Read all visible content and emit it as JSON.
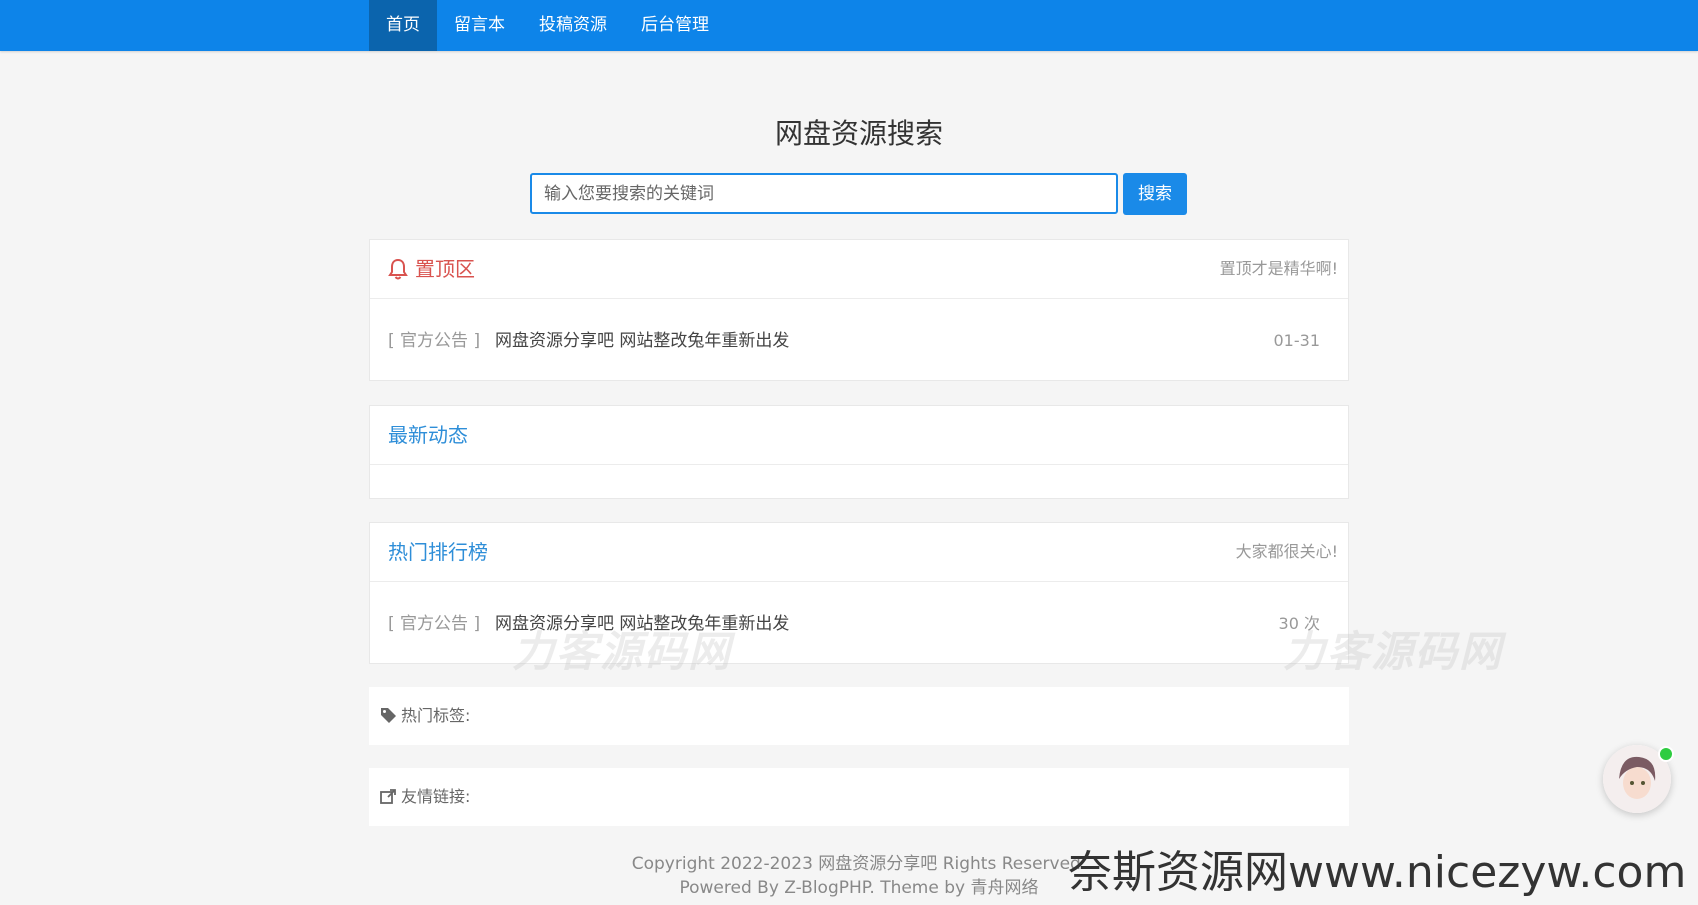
{
  "nav": {
    "items": [
      {
        "label": "首页"
      },
      {
        "label": "留言本"
      },
      {
        "label": "投稿资源"
      },
      {
        "label": "后台管理"
      }
    ]
  },
  "search": {
    "title": "网盘资源搜索",
    "placeholder": "输入您要搜索的关键词",
    "button": "搜索"
  },
  "pinned": {
    "title": "置顶区",
    "subtitle": "置顶才是精华啊!",
    "items": [
      {
        "category": "[ 官方公告 ]",
        "title": "网盘资源分享吧 网站整改兔年重新出发",
        "date": "01-31"
      }
    ]
  },
  "latest": {
    "title": "最新动态"
  },
  "hot": {
    "title": "热门排行榜",
    "subtitle": "大家都很关心!",
    "items": [
      {
        "category": "[ 官方公告 ]",
        "title": "网盘资源分享吧 网站整改兔年重新出发",
        "views": "30 次"
      }
    ]
  },
  "tags": {
    "label": "热门标签:"
  },
  "links": {
    "label": "友情链接:"
  },
  "watermarks": {
    "center": "力客源码网",
    "right": "力客源码网",
    "bottom": "奈斯资源网www.nicezyw.com"
  },
  "footer": {
    "copyright": "Copyright 2022-2023 网盘资源分享吧 Rights Reserved.",
    "powered": "Powered By Z-BlogPHP. Theme by 青舟网络"
  },
  "colors": {
    "primary": "#0d84e9",
    "active": "#0b64ad",
    "accent": "#2e8ed8",
    "pinned": "#d9534f"
  }
}
